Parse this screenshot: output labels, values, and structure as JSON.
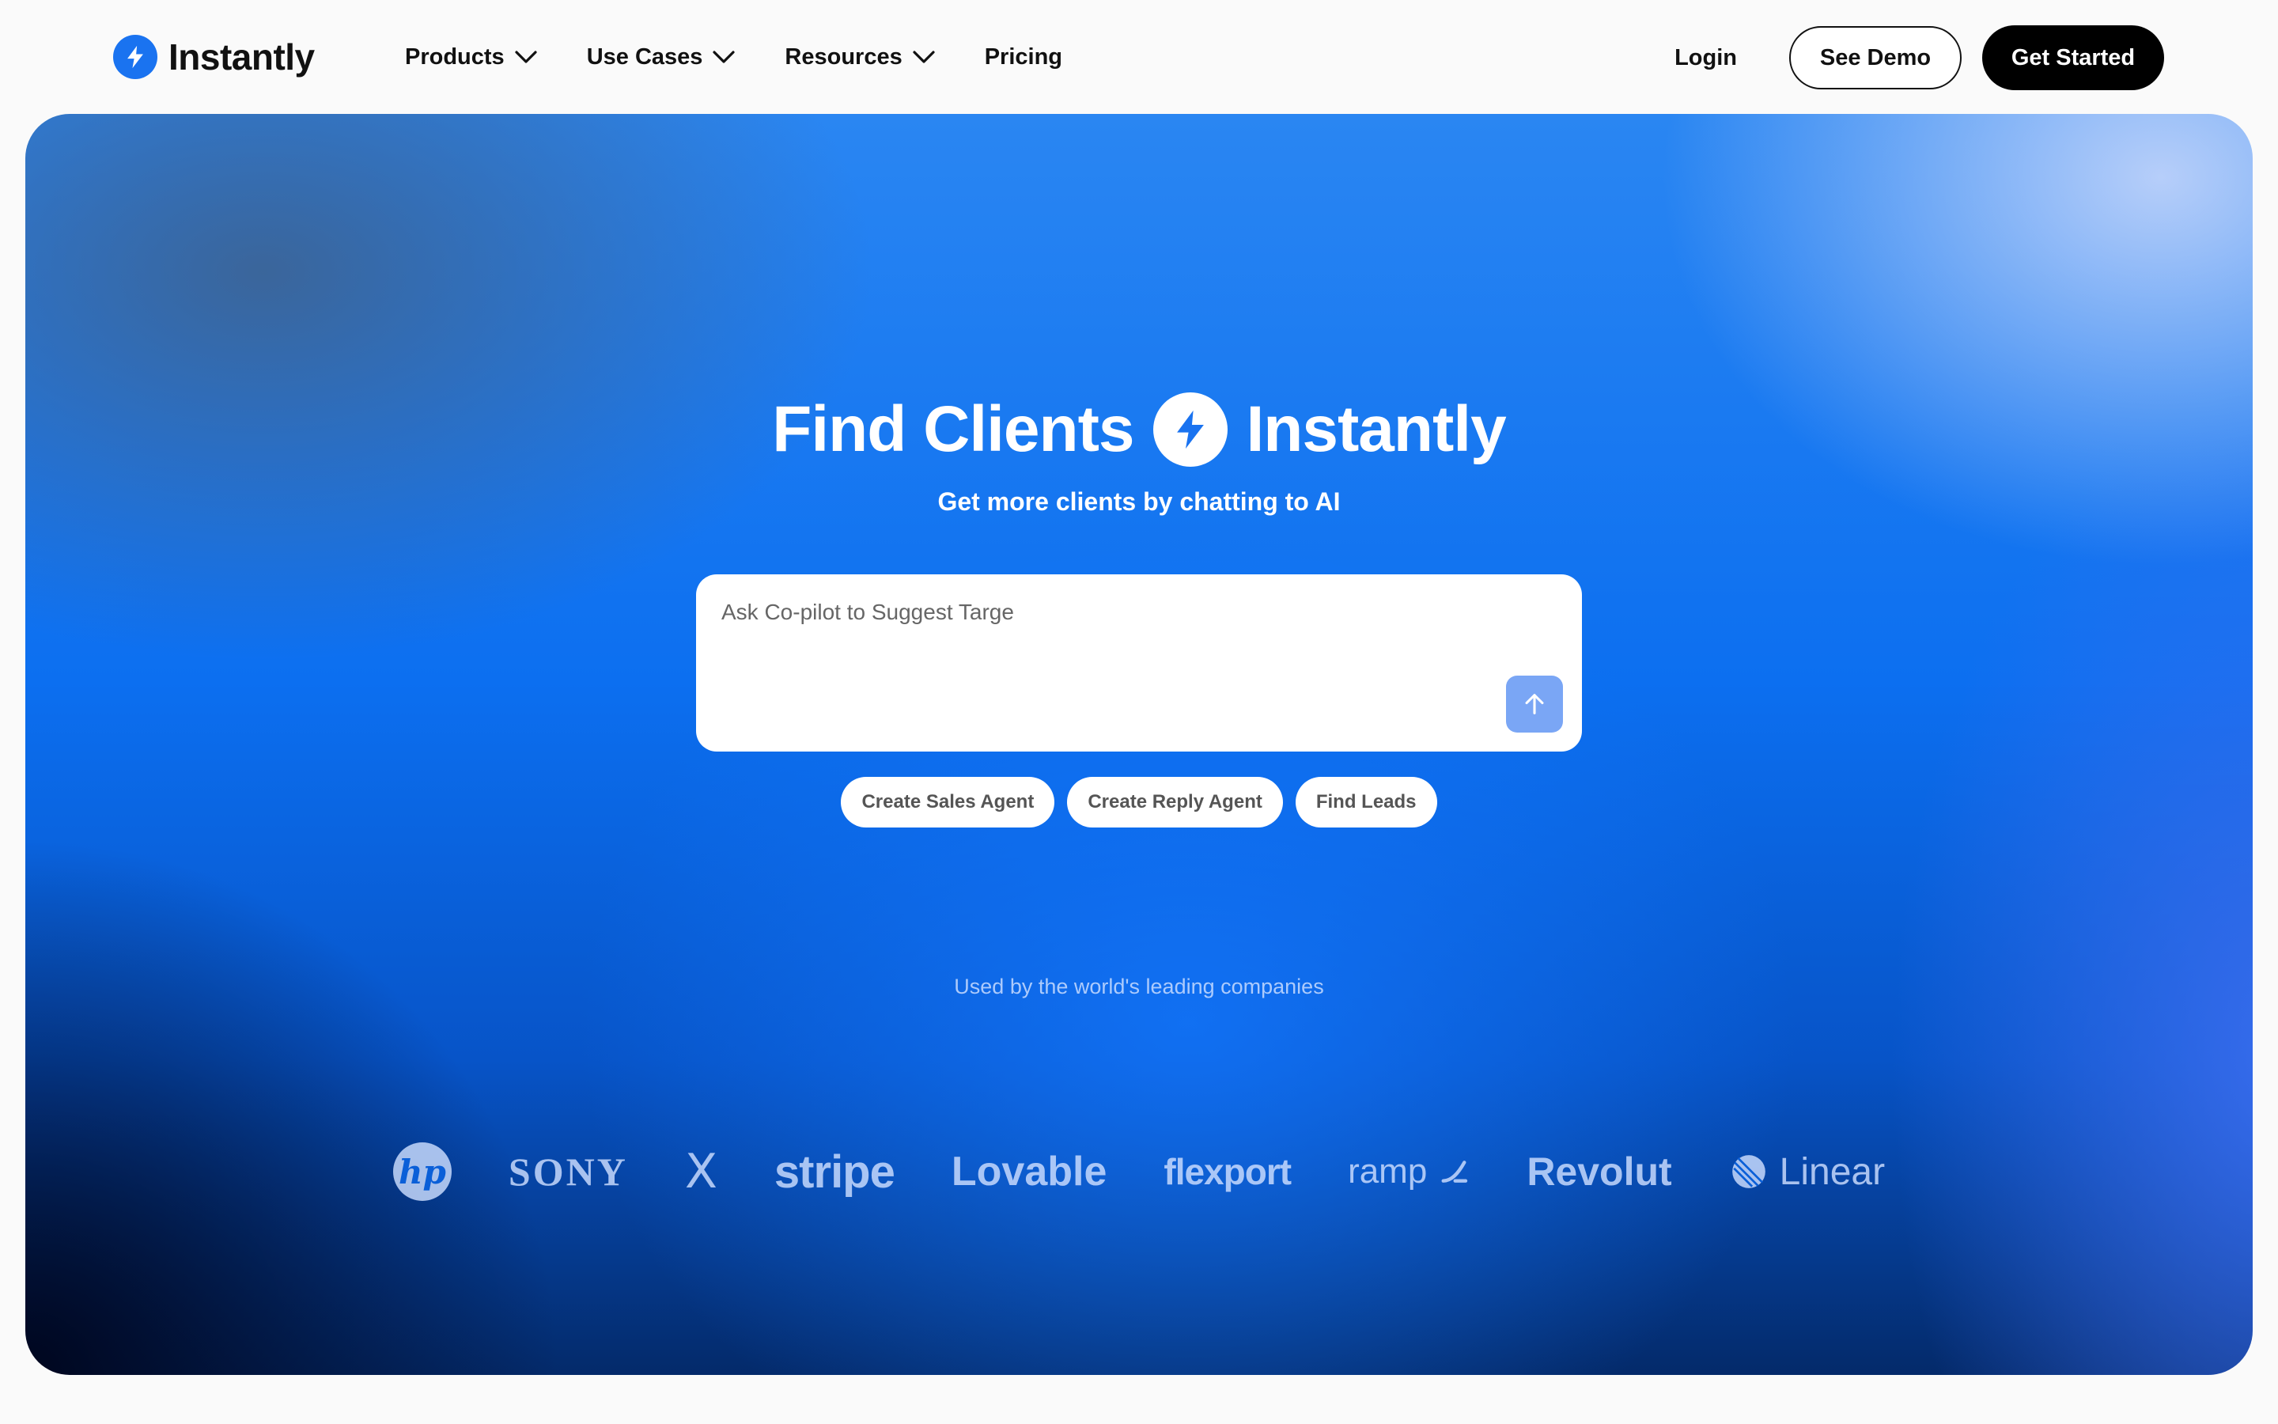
{
  "brand": {
    "name": "Instantly",
    "color": "#1a73f0"
  },
  "nav": {
    "items": [
      {
        "label": "Products",
        "has_dropdown": true
      },
      {
        "label": "Use Cases",
        "has_dropdown": true
      },
      {
        "label": "Resources",
        "has_dropdown": true
      },
      {
        "label": "Pricing",
        "has_dropdown": false
      }
    ],
    "login": "Login",
    "see_demo": "See Demo",
    "get_started": "Get Started"
  },
  "hero": {
    "title_left": "Find Clients",
    "title_right": "Instantly",
    "subtitle": "Get more clients by chatting to AI",
    "prompt_placeholder": "Ask Co-pilot to Suggest Targe",
    "chips": [
      "Create Sales Agent",
      "Create Reply Agent",
      "Find Leads"
    ],
    "used_by": "Used by the world's leading companies",
    "logos": {
      "hp": "hp",
      "sony": "SONY",
      "x": "X",
      "stripe": "stripe",
      "lovable": "Lovable",
      "flexport": "flexport",
      "ramp": "ramp",
      "revolut": "Revolut",
      "linear": "Linear"
    }
  },
  "icons": {
    "brand": "lightning-bolt-icon",
    "dropdown": "chevron-down-icon",
    "send": "arrow-up-icon"
  },
  "colors": {
    "accent": "#1a73f0",
    "primary_button": "#000000",
    "send_button": "#7aa6f5"
  }
}
